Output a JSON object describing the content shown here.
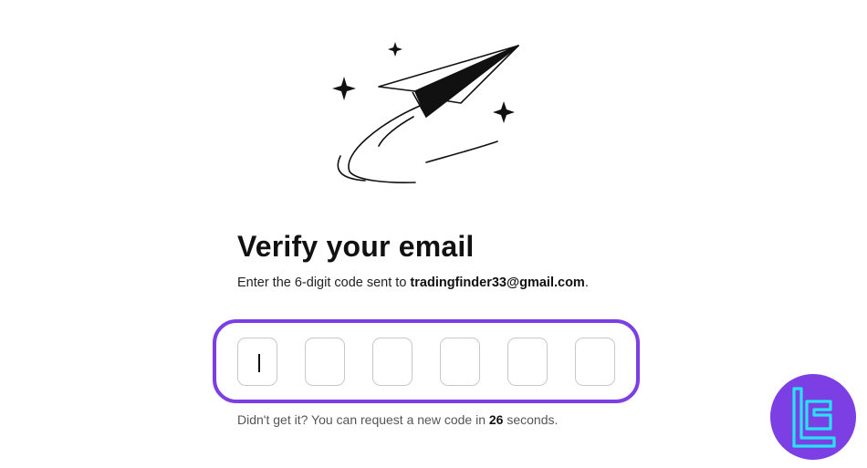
{
  "illustration": {
    "icon": "paper-plane-icon",
    "sparkles": [
      "sparkle-icon",
      "sparkle-icon",
      "sparkle-icon"
    ]
  },
  "heading": "Verify your email",
  "instruction": {
    "prefix": "Enter the 6-digit code sent to ",
    "email": "tradingfinder33@gmail.com",
    "suffix": "."
  },
  "code_inputs": {
    "count": 6,
    "values": [
      "",
      "",
      "",
      "",
      "",
      ""
    ],
    "active_index": 0
  },
  "resend": {
    "prefix": "Didn't get it? You can request a new code in ",
    "seconds": "26",
    "suffix": " seconds."
  },
  "colors": {
    "accent": "#7b3fe4",
    "badge_logo": "#27e3f2",
    "text": "#111111",
    "muted": "#555555",
    "box_border": "#c8c8cc"
  },
  "brand_badge": {
    "icon": "tradingfinder-logo-icon"
  }
}
